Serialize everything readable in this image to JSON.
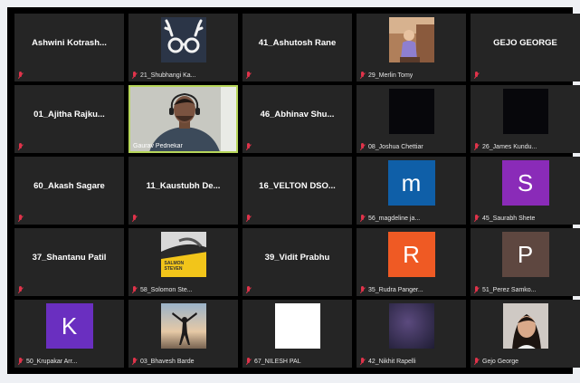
{
  "meeting": {
    "tiles": [
      {
        "mode": "name",
        "name": "Ashwini  Kotrash..."
      },
      {
        "mode": "pic",
        "pic": "reindeer-glasses",
        "label": "21_Shubhangi Ka..."
      },
      {
        "mode": "name",
        "name": "41_Ashutosh Rane"
      },
      {
        "mode": "pic",
        "pic": "child-photo",
        "label": "29_Merlin Tomy"
      },
      {
        "mode": "name",
        "name": "GEJO GEORGE"
      },
      {
        "mode": "name",
        "name": "01_Ajitha  Rajku..."
      },
      {
        "mode": "video",
        "label": "Gaurav Pednekar"
      },
      {
        "mode": "name",
        "name": "46_Abhinav  Shu..."
      },
      {
        "mode": "pic",
        "pic": "dark-square",
        "label": "08_Joshua Chettiar"
      },
      {
        "mode": "pic",
        "pic": "dark-square",
        "label": "26_James Kundu..."
      },
      {
        "mode": "name",
        "name": "60_Akash Sagare"
      },
      {
        "mode": "name",
        "name": "11_Kaustubh  De..."
      },
      {
        "mode": "name",
        "name": "16_VELTON  DSO..."
      },
      {
        "mode": "avatar",
        "letter": "m",
        "color": "#0f5fa8",
        "label": "56_magdeline ja..."
      },
      {
        "mode": "avatar",
        "letter": "S",
        "color": "#8a2bb8",
        "label": "45_Saurabh Shete"
      },
      {
        "mode": "name",
        "name": "37_Shantanu Patil"
      },
      {
        "mode": "pic",
        "pic": "poster-yellow",
        "label": "58_Solomon Ste..."
      },
      {
        "mode": "name",
        "name": "39_Vidit Prabhu"
      },
      {
        "mode": "avatar",
        "letter": "R",
        "color": "#ef5a24",
        "label": "35_Rudra Panger..."
      },
      {
        "mode": "avatar",
        "letter": "P",
        "color": "#5e4740",
        "label": "51_Perez Samko..."
      },
      {
        "mode": "avatar",
        "letter": "K",
        "color": "#6a2fc0",
        "label": "50_Krupakar Arr..."
      },
      {
        "mode": "pic",
        "pic": "beach-silhouette",
        "label": "03_Bhavesh Barde"
      },
      {
        "mode": "pic",
        "pic": "white-square",
        "label": "67_NILESH PAL"
      },
      {
        "mode": "pic",
        "pic": "purple-blur",
        "label": "42_Nikhit Rapelli"
      },
      {
        "mode": "pic",
        "pic": "girl-portrait",
        "label": "Gejo George"
      }
    ],
    "active_speaker_index": 6,
    "poster_text": "SALMON STEVEN"
  }
}
